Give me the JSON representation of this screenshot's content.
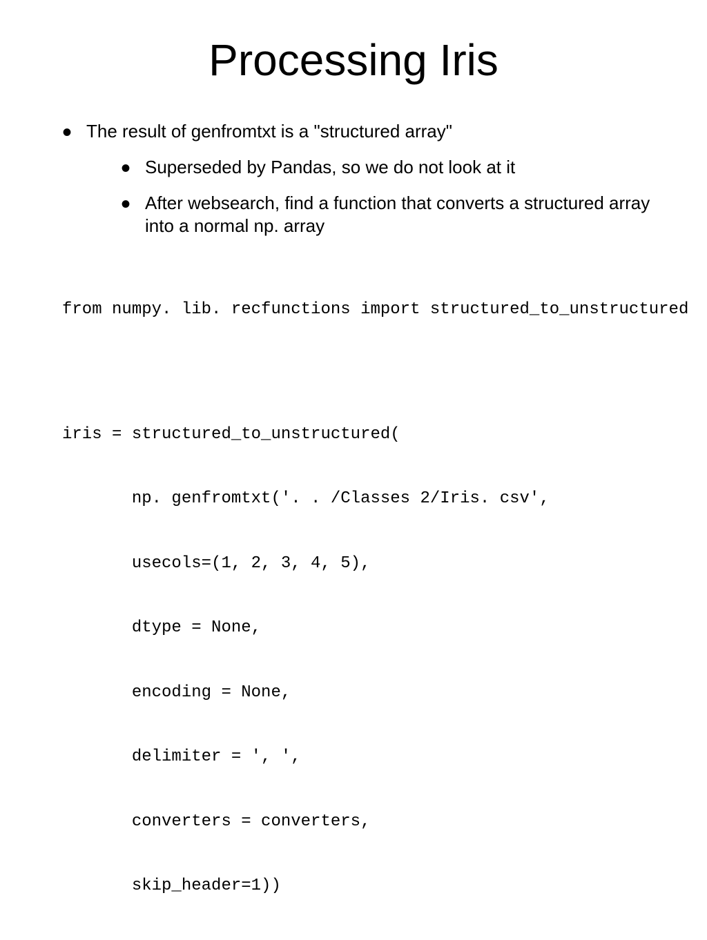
{
  "slide": {
    "title": "Processing Iris",
    "bullet1": "The result of genfromtxt is a \"structured array\"",
    "subbullet1": "Superseded by Pandas, so we do not look at it",
    "subbullet2": "After websearch, find a function that converts a structured array into a normal np. array",
    "code1": "from numpy. lib. recfunctions import structured_to_unstructured",
    "code2_line1": "iris = structured_to_unstructured(",
    "code2_line2": "       np. genfromtxt('. . /Classes 2/Iris. csv',",
    "code2_line3": "       usecols=(1, 2, 3, 4, 5),",
    "code2_line4": "       dtype = None,",
    "code2_line5": "       encoding = None,",
    "code2_line6": "       delimiter = ', ',",
    "code2_line7": "       converters = converters,",
    "code2_line8": "       skip_header=1))"
  }
}
